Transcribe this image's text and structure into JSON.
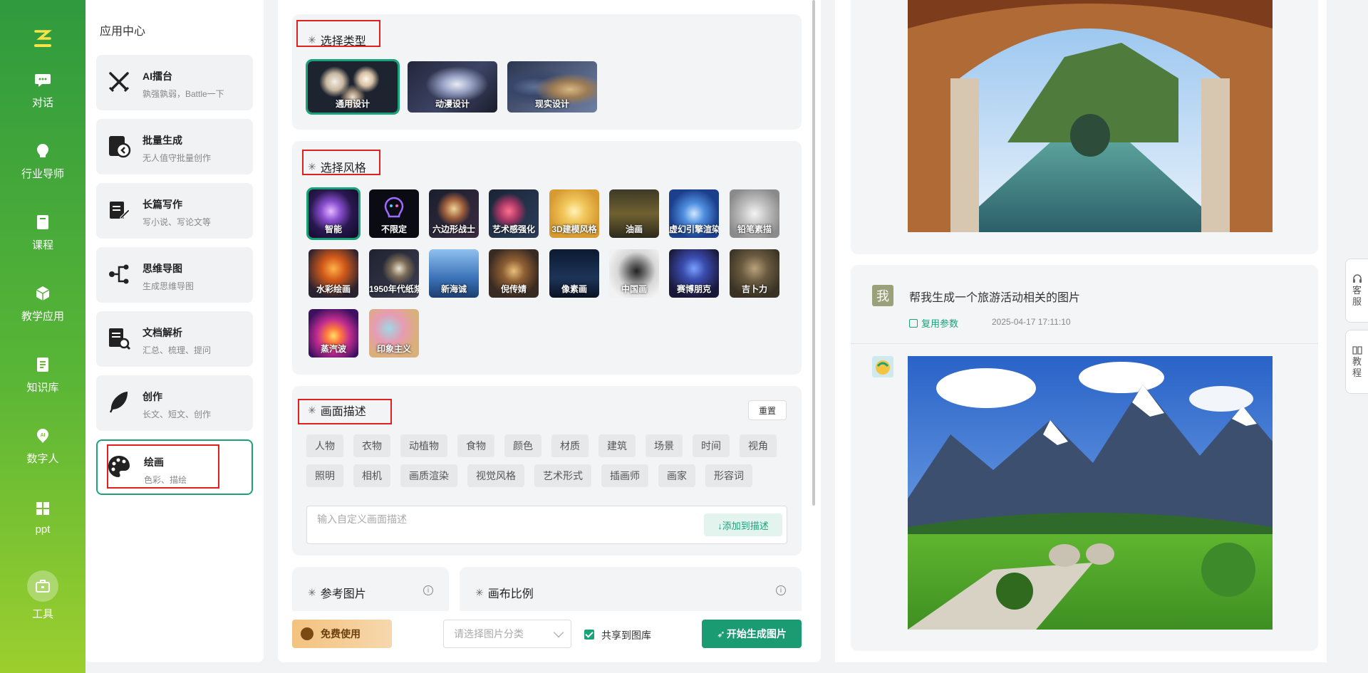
{
  "rail": {
    "items": [
      {
        "label": "对话",
        "icon": "chat-icon"
      },
      {
        "label": "行业导师",
        "icon": "mentor-icon"
      },
      {
        "label": "课程",
        "icon": "course-icon"
      },
      {
        "label": "教学应用",
        "icon": "cube-icon"
      },
      {
        "label": "知识库",
        "icon": "knowledge-icon"
      },
      {
        "label": "数字人",
        "icon": "ai-person-icon"
      },
      {
        "label": "ppt",
        "icon": "ppt-icon"
      },
      {
        "label": "工具",
        "icon": "toolbox-icon"
      }
    ]
  },
  "apps": {
    "title": "应用中心",
    "items": [
      {
        "name": "AI擂台",
        "desc": "孰强孰弱，Battle一下"
      },
      {
        "name": "批量生成",
        "desc": "无人值守批量创作"
      },
      {
        "name": "长篇写作",
        "desc": "写小说、写论文等"
      },
      {
        "name": "思维导图",
        "desc": "生成思维导图"
      },
      {
        "name": "文档解析",
        "desc": "汇总、梳理、提问"
      },
      {
        "name": "创作",
        "desc": "长文、短文、创作"
      },
      {
        "name": "绘画",
        "desc": "色彩、描绘"
      }
    ]
  },
  "form": {
    "type_section": {
      "title": "选择类型",
      "options": [
        "通用设计",
        "动漫设计",
        "现实设计"
      ]
    },
    "style_section": {
      "title": "选择风格",
      "options": [
        "智能",
        "不限定",
        "六边形战士",
        "艺术感强化",
        "3D建模风格",
        "油画",
        "虚幻引擎渲染",
        "铅笔素描",
        "水彩绘画",
        "1950年代纸浆",
        "新海诚",
        "倪传婧",
        "像素画",
        "中国画",
        "赛博朋克",
        "吉卜力",
        "蒸汽波",
        "印象主义"
      ]
    },
    "desc_section": {
      "title": "画面描述",
      "reset": "重置",
      "tags_row1": [
        "人物",
        "衣物",
        "动植物",
        "食物",
        "颜色",
        "材质",
        "建筑",
        "场景",
        "时间",
        "视角"
      ],
      "tags_row2": [
        "照明",
        "相机",
        "画质渲染",
        "视觉风格",
        "艺术形式",
        "插画师",
        "画家",
        "形容词"
      ],
      "placeholder": "输入自定义画面描述",
      "add_button": "↓添加到描述"
    },
    "ref_title": "参考图片",
    "ratio_title": "画布比例",
    "bottom": {
      "free": "免费使用",
      "category_placeholder": "请选择图片分类",
      "share_label": "共享到图库",
      "generate": "开始生成图片"
    }
  },
  "results": {
    "avatar_me": "我",
    "prompt": "帮我生成一个旅游活动相关的图片",
    "reuse": "复用参数",
    "time": "2025-04-17 17:11:10"
  },
  "side": {
    "service": [
      "客",
      "服"
    ],
    "tutorial": [
      "教",
      "程"
    ]
  },
  "colors": {
    "accent": "#1aa37a",
    "rail_top": "#2f9a3e",
    "rail_bottom": "#9ccf2e",
    "highlight_box": "#e0201f"
  }
}
